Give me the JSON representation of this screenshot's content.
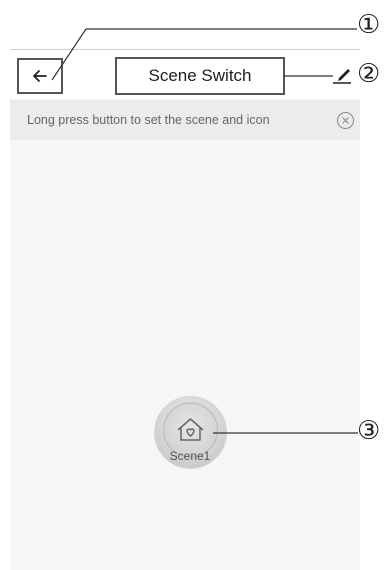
{
  "header": {
    "title": "Scene Switch"
  },
  "banner": {
    "text": "Long press button to set the scene and icon"
  },
  "scene": {
    "label": "Scene1"
  },
  "callouts": {
    "one": "①",
    "two": "②",
    "three": "③"
  },
  "icons": {
    "back": "arrow-left-icon",
    "edit": "pencil-icon",
    "close": "close-circle-icon",
    "scene": "home-heart-icon"
  },
  "colors": {
    "banner_bg": "#ececec",
    "content_bg": "#f6f6f6",
    "annotation": "#555555"
  }
}
